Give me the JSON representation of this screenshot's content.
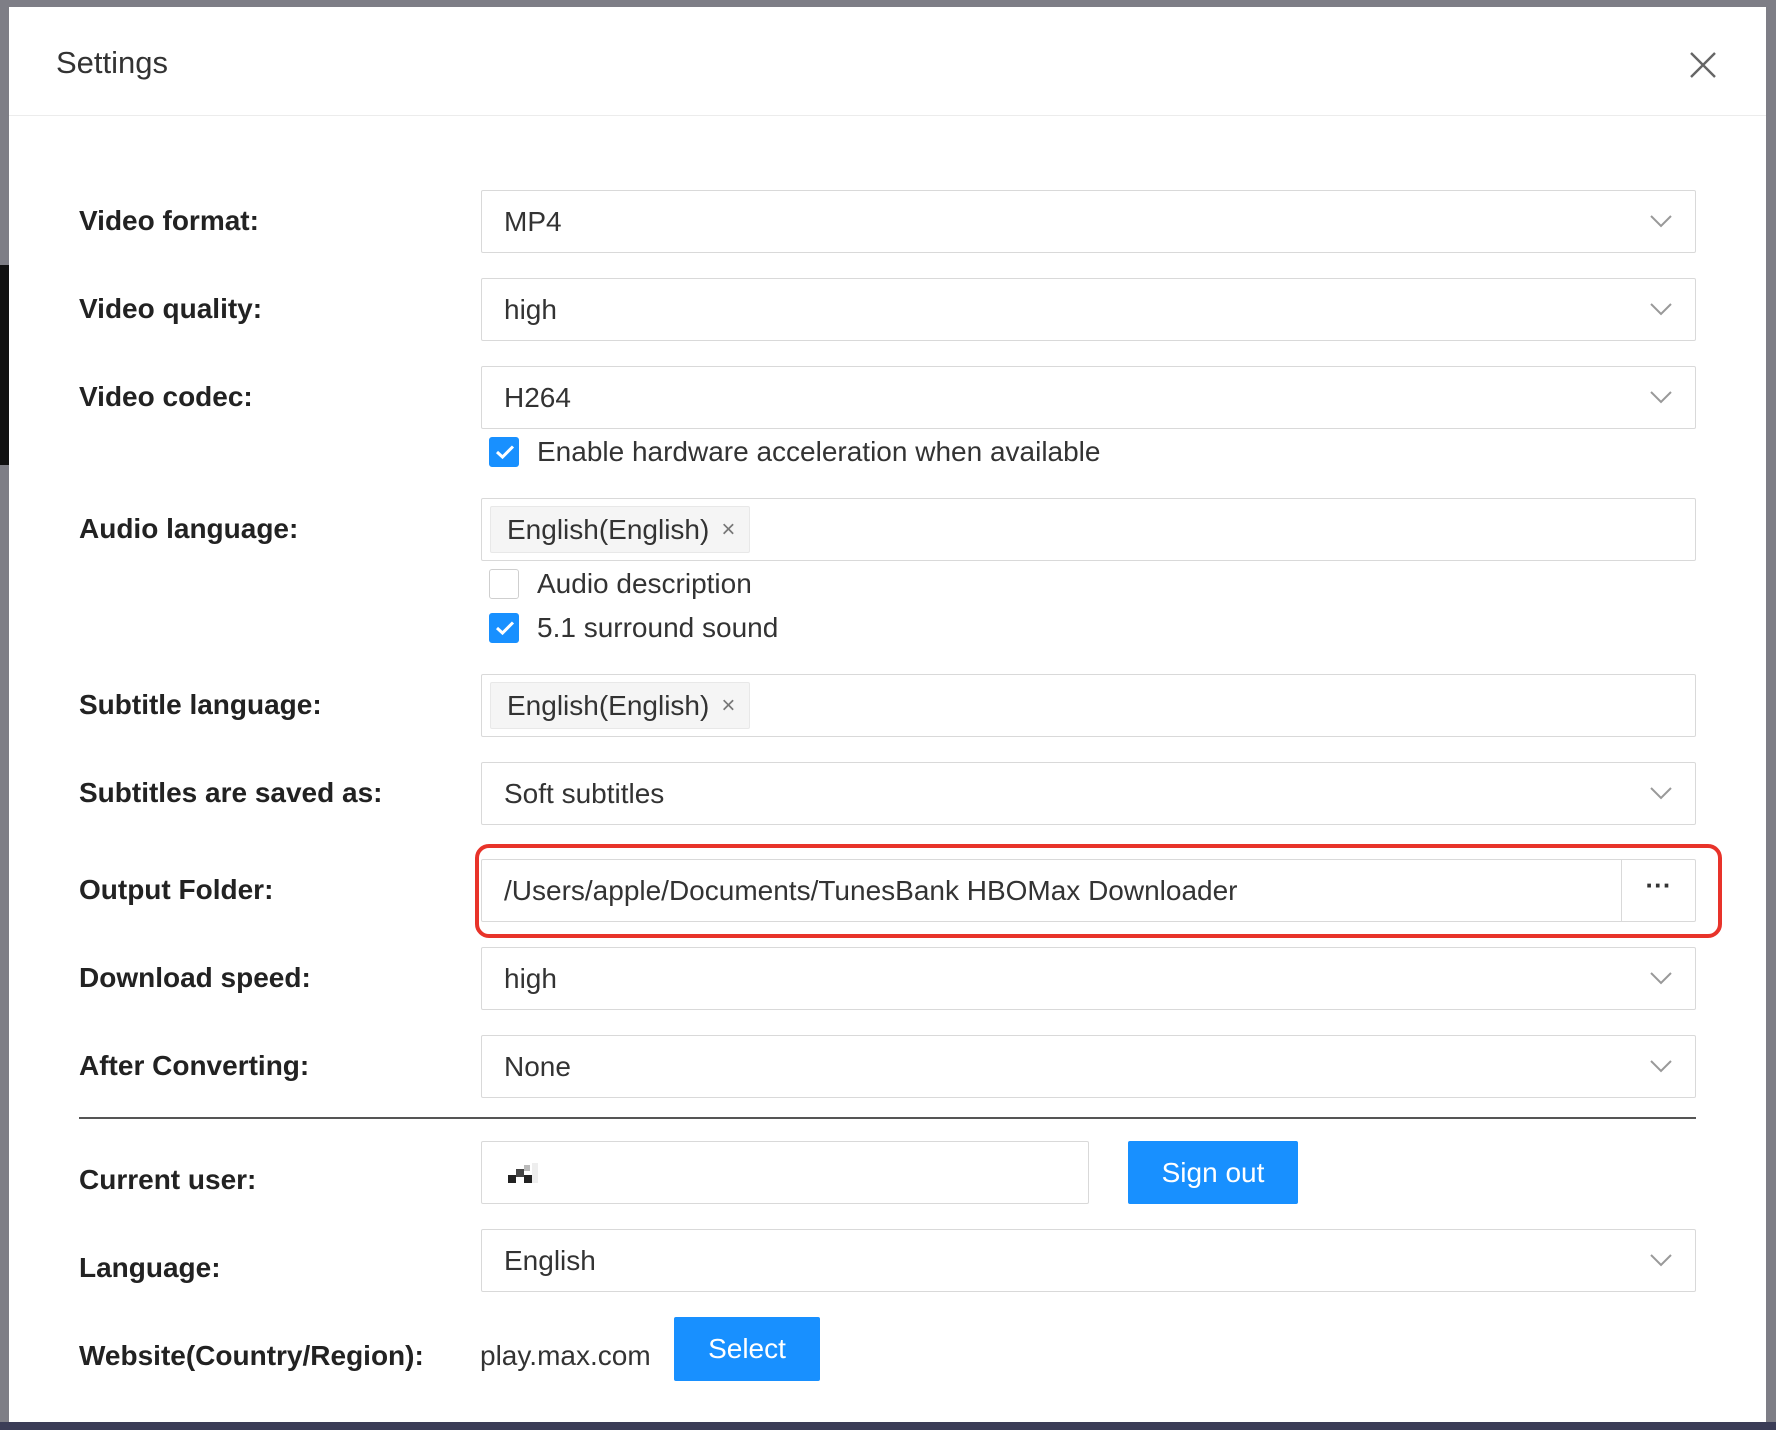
{
  "dialog": {
    "title": "Settings"
  },
  "settings": {
    "video_format": {
      "label": "Video format:",
      "value": "MP4"
    },
    "video_quality": {
      "label": "Video quality:",
      "value": "high"
    },
    "video_codec": {
      "label": "Video codec:",
      "value": "H264",
      "hw_accel": {
        "label": "Enable hardware acceleration when available",
        "checked": true
      }
    },
    "audio_language": {
      "label": "Audio language:",
      "tag": "English(English)",
      "tag_remove": "×",
      "audio_description": {
        "label": "Audio description",
        "checked": false
      },
      "surround": {
        "label": "5.1 surround sound",
        "checked": true
      }
    },
    "subtitle_language": {
      "label": "Subtitle language:",
      "tag": "English(English)",
      "tag_remove": "×"
    },
    "subtitles_saved_as": {
      "label": "Subtitles are saved as:",
      "value": "Soft subtitles"
    },
    "output_folder": {
      "label": "Output Folder:",
      "value": "/Users/apple/Documents/TunesBank HBOMax Downloader",
      "browse_label": "···"
    },
    "download_speed": {
      "label": "Download speed:",
      "value": "high"
    },
    "after_converting": {
      "label": "After Converting:",
      "value": "None"
    }
  },
  "account": {
    "current_user": {
      "label": "Current user:"
    },
    "sign_out_label": "Sign out",
    "language": {
      "label": "Language:",
      "value": "English"
    },
    "website": {
      "label": "Website(Country/Region):",
      "value": "play.max.com",
      "select_label": "Select"
    }
  },
  "colors": {
    "accent": "#1890ff",
    "highlight_border": "#e8332a"
  },
  "icons": {
    "close": "close-icon",
    "dropdown": "chevron-down-icon",
    "checkbox": "check-icon",
    "more": "ellipsis-icon"
  }
}
